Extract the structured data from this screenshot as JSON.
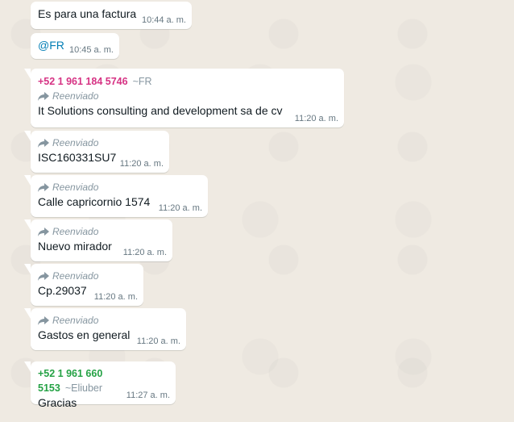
{
  "messages": [
    {
      "text": "Es para una factura",
      "time": "10:44 a. m."
    },
    {
      "text": "@FR",
      "time": "10:45 a. m."
    },
    {
      "sender": "+52 1 961 184 5746",
      "sender_color": "#d63384",
      "push_name": "~FR",
      "forwarded_label": "Reenviado",
      "text": "It Solutions consulting and development sa de cv",
      "time": "11:20 a. m."
    },
    {
      "forwarded_label": "Reenviado",
      "text": "ISC160331SU7",
      "time": "11:20 a. m."
    },
    {
      "forwarded_label": "Reenviado",
      "text": "Calle capricornio 1574",
      "time": "11:20 a. m."
    },
    {
      "forwarded_label": "Reenviado",
      "text": "Nuevo mirador",
      "time": "11:20 a. m."
    },
    {
      "forwarded_label": "Reenviado",
      "text": "Cp.29037",
      "time": "11:20 a. m."
    },
    {
      "forwarded_label": "Reenviado",
      "text": "Gastos en general",
      "time": "11:20 a. m."
    },
    {
      "sender": "+52 1 961 660 5153",
      "sender_color": "#25a245",
      "push_name": "~Eliuber",
      "text": "Gracias",
      "time": "11:27 a. m."
    }
  ],
  "colors": {
    "chat_bg": "#efeae2",
    "bubble": "#ffffff",
    "mention": "#027eb5"
  }
}
